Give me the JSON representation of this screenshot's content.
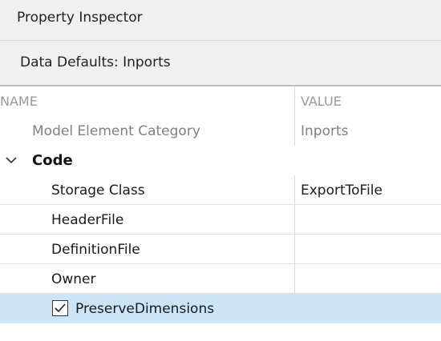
{
  "panel": {
    "title": "Property Inspector",
    "subheader": "Data Defaults: Inports"
  },
  "table": {
    "columns": {
      "name": "NAME",
      "value": "VALUE"
    },
    "category_row": {
      "name": "Model Element Category",
      "value": "Inports"
    },
    "group": {
      "name": "Code",
      "expanded": true
    },
    "rows": [
      {
        "name": "Storage Class",
        "value": "ExportToFile"
      },
      {
        "name": "HeaderFile",
        "value": ""
      },
      {
        "name": "DefinitionFile",
        "value": ""
      },
      {
        "name": "Owner",
        "value": ""
      }
    ],
    "checkbox_row": {
      "name": "PreserveDimensions",
      "checked": true,
      "selected": true
    }
  },
  "colors": {
    "header_bg": "#f0f0f0",
    "selection": "#cce4f7",
    "muted_text": "#808080"
  },
  "icons": {
    "group_toggle": "chevron-down-icon",
    "checkbox": "checkbox-checked-icon"
  }
}
